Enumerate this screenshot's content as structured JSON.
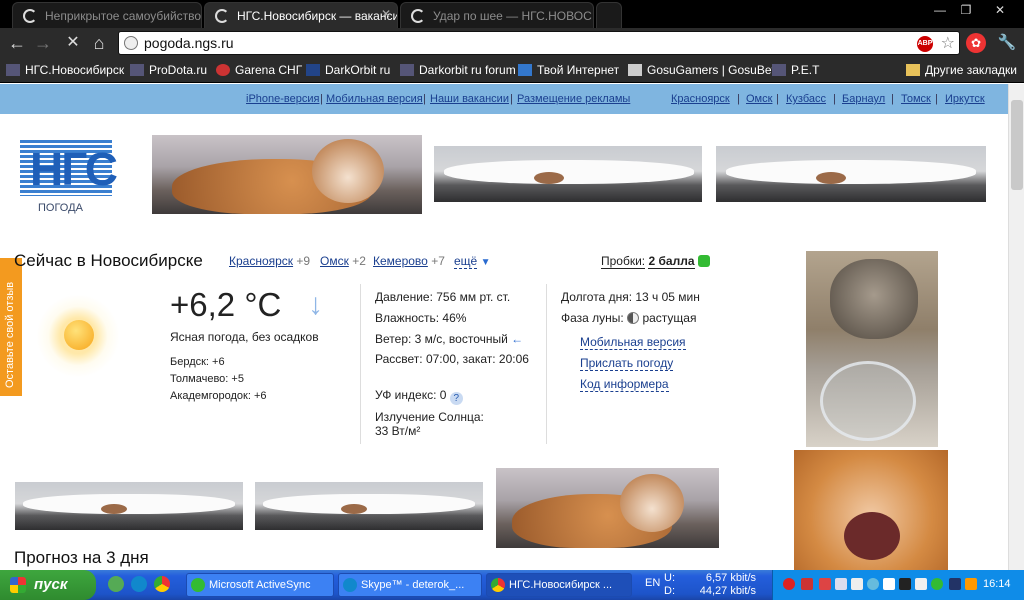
{
  "tabs": [
    {
      "title": "Неприкрытое самоубийство"
    },
    {
      "title": "НГС.Новосибирск — ваканси"
    },
    {
      "title": "Удар по шее — НГС.НОВОС"
    }
  ],
  "window_controls": {
    "minimize": "—",
    "maximize": "❐",
    "close": "✕"
  },
  "toolbar": {
    "back": "←",
    "forward": "→",
    "stop": "✕",
    "home": "⌂",
    "url": "pogoda.ngs.ru",
    "adblock_label": "ABP",
    "menu": "🔧"
  },
  "bookmarks": [
    "НГС.Новосибирск",
    "ProDota.ru",
    "Garena СНГ",
    "DarkOrbit ru",
    "Darkorbit ru forum",
    "Твой Интернет",
    "GosuGamers | GosuBet",
    "P.E.T",
    "Другие закладки"
  ],
  "topnav": {
    "left": [
      "iPhone-версия",
      "Мобильная версия",
      "Наши вакансии",
      "Размещение рекламы"
    ],
    "right": [
      "Красноярск",
      "Омск",
      "Кузбасс",
      "Барнаул",
      "Томск",
      "Иркутск"
    ]
  },
  "logo": {
    "text": "НГС",
    "sub": "ПОГОДА"
  },
  "feedback_label": "Оставьте свой отзыв",
  "now": {
    "heading": "Сейчас в Новосибирске",
    "cities": [
      {
        "name": "Красноярск",
        "temp": "+9"
      },
      {
        "name": "Омск",
        "temp": "+2"
      },
      {
        "name": "Кемерово",
        "temp": "+7"
      }
    ],
    "more": "ещё",
    "traffic_label": "Пробки:",
    "traffic_value": "2 балла",
    "temperature": "+6,2 °C",
    "description": "Ясная погода, без осадков",
    "nearby": [
      "Бердск: +6",
      "Толмачево: +5",
      "Академгородок: +6"
    ],
    "pressure": "Давление: 756 мм рт. ст.",
    "humidity": "Влажность: 46%",
    "wind": "Ветер: 3 м/с, восточный",
    "sun": "Рассвет: 07:00, закат: 20:06",
    "uv": "УФ индекс: 0",
    "radiation_label": "Излучение Солнца:",
    "radiation_value": "33 Вт/м²",
    "day_length": "Долгота дня: 13 ч 05 мин",
    "moon": "Фаза луны:",
    "moon_value": "растущая",
    "links": [
      "Мобильная версия",
      "Прислать погоду",
      "Код информера"
    ]
  },
  "forecast_heading": "Прогноз на 3 дня",
  "taskbar": {
    "start": "пуск",
    "windows": [
      "Microsoft ActiveSync",
      "Skype™ - deterok_...",
      "НГС.Новосибирск ..."
    ],
    "lang": "EN",
    "upload_label": "U:",
    "download_label": "D:",
    "upload": "6,57 kbit/s",
    "download": "44,27 kbit/s",
    "clock": "16:14"
  }
}
